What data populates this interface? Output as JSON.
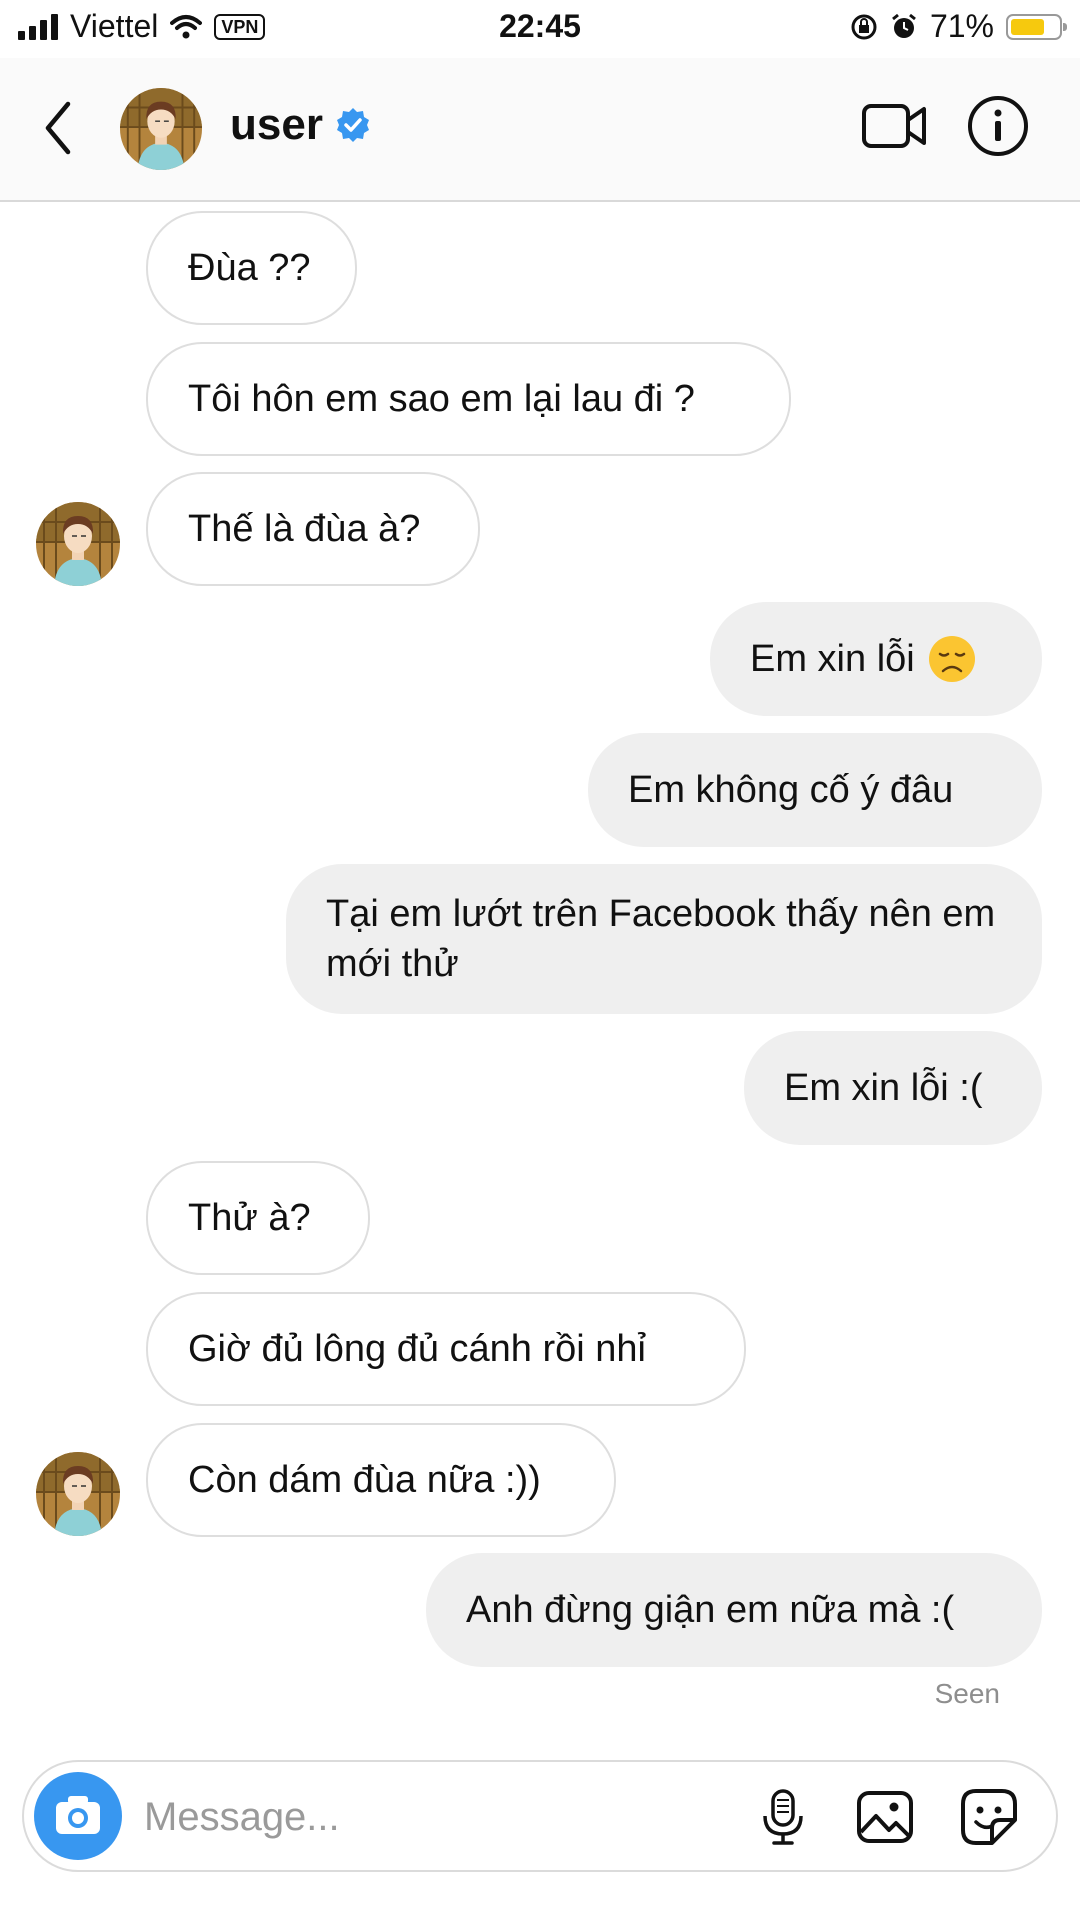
{
  "status_bar": {
    "carrier": "Viettel",
    "vpn": "VPN",
    "time": "22:45",
    "battery": "71%",
    "battery_level": 0.71,
    "battery_color": "#f6c90e"
  },
  "header": {
    "username": "user",
    "verified_color": "#3897f0",
    "icons": [
      "back-arrow-icon",
      "verified-badge-icon",
      "video-call-icon",
      "info-icon"
    ]
  },
  "messages": [
    {
      "from": "them",
      "text": "Đùa ??"
    },
    {
      "from": "them",
      "text": "Tôi hôn em sao em lại lau đi ?"
    },
    {
      "from": "them",
      "text": "Thế là đùa à?"
    },
    {
      "from": "me",
      "text": "Em xin lỗi",
      "emoji": "disappointed-face"
    },
    {
      "from": "me",
      "text": "Em không cố ý đâu"
    },
    {
      "from": "me",
      "text": "Tại em lướt trên Facebook thấy nên em mới thử"
    },
    {
      "from": "me",
      "text": "Em xin lỗi :("
    },
    {
      "from": "them",
      "text": "Thử à?"
    },
    {
      "from": "them",
      "text": "Giờ đủ lông đủ cánh rồi nhỉ"
    },
    {
      "from": "them",
      "text": "Còn dám đùa nữa :))"
    },
    {
      "from": "me",
      "text": "Anh đừng giận em nữa mà :("
    }
  ],
  "seen_label": "Seen",
  "composer": {
    "placeholder": "Message...",
    "camera_color": "#3897f0",
    "icons": [
      "camera-icon",
      "microphone-icon",
      "gallery-icon",
      "sticker-icon"
    ]
  }
}
